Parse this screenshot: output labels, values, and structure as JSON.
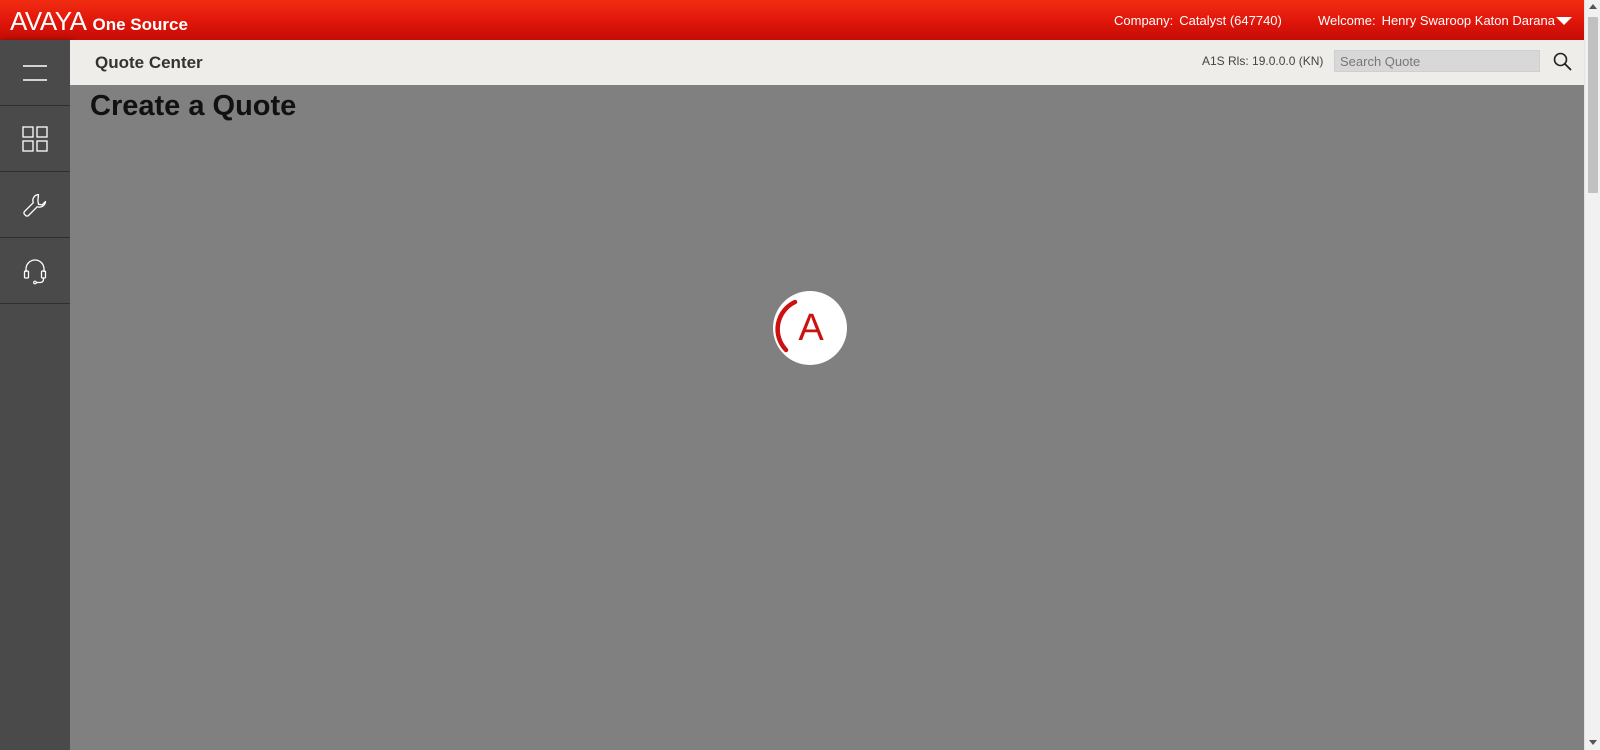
{
  "brand": {
    "logo_text": "AVAYA",
    "product_name": "One Source",
    "primary_color": "#e0150a"
  },
  "topbar": {
    "company_label": "Company:",
    "company_value": "Catalyst (647740)",
    "welcome_label": "Welcome:",
    "welcome_value": "Henry Swaroop Katon Darana",
    "user_menu_icon": "caret-down-icon"
  },
  "sidebar": {
    "items": [
      {
        "name": "menu",
        "icon": "hamburger-icon"
      },
      {
        "name": "dashboard",
        "icon": "grid-icon"
      },
      {
        "name": "tools",
        "icon": "wrench-icon"
      },
      {
        "name": "support",
        "icon": "headset-icon"
      }
    ]
  },
  "header": {
    "title": "Quote Center",
    "release": "A1S Rls: 19.0.0.0 (KN)",
    "search": {
      "placeholder": "Search Quote",
      "value": ""
    }
  },
  "main": {
    "heading": "Create a Quote",
    "loading_logo_letter": "A"
  }
}
